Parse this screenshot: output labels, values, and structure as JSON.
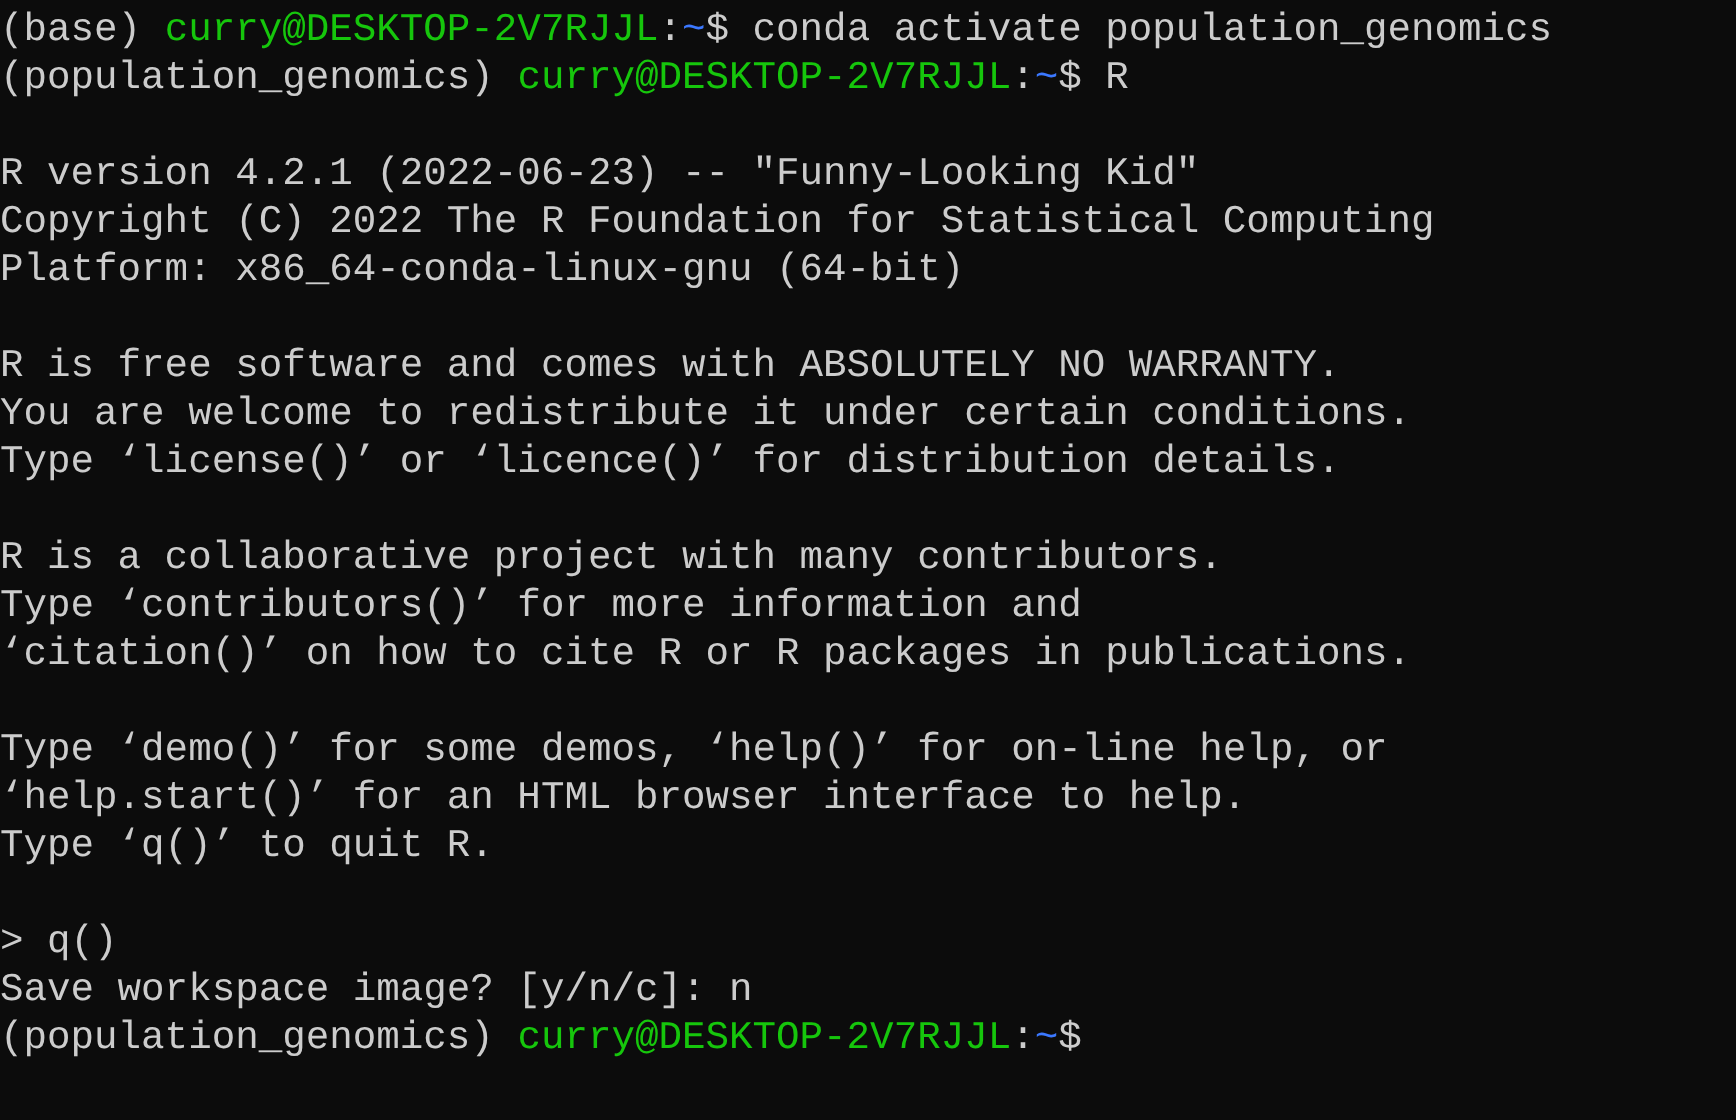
{
  "terminal": {
    "blocks": [
      {
        "lines": [
          {
            "segments": [
              {
                "kind": "plain",
                "text": "(base) "
              },
              {
                "kind": "user",
                "text": "curry@DESKTOP-2V7RJJL"
              },
              {
                "kind": "plain",
                "text": ":"
              },
              {
                "kind": "path",
                "text": "~"
              },
              {
                "kind": "plain",
                "text": "$ conda activate population_genomics"
              }
            ]
          },
          {
            "segments": [
              {
                "kind": "plain",
                "text": "(population_genomics) "
              },
              {
                "kind": "user",
                "text": "curry@DESKTOP-2V7RJJL"
              },
              {
                "kind": "plain",
                "text": ":"
              },
              {
                "kind": "path",
                "text": "~"
              },
              {
                "kind": "plain",
                "text": "$ R"
              }
            ]
          }
        ]
      },
      {
        "lines": [
          {
            "segments": [
              {
                "kind": "plain",
                "text": "R version 4.2.1 (2022-06-23) -- \"Funny-Looking Kid\""
              }
            ]
          },
          {
            "segments": [
              {
                "kind": "plain",
                "text": "Copyright (C) 2022 The R Foundation for Statistical Computing"
              }
            ]
          },
          {
            "segments": [
              {
                "kind": "plain",
                "text": "Platform: x86_64-conda-linux-gnu (64-bit)"
              }
            ]
          }
        ]
      },
      {
        "lines": [
          {
            "segments": [
              {
                "kind": "plain",
                "text": "R is free software and comes with ABSOLUTELY NO WARRANTY."
              }
            ]
          },
          {
            "segments": [
              {
                "kind": "plain",
                "text": "You are welcome to redistribute it under certain conditions."
              }
            ]
          },
          {
            "segments": [
              {
                "kind": "plain",
                "text": "Type ‘license()’ or ‘licence()’ for distribution details."
              }
            ]
          }
        ]
      },
      {
        "lines": [
          {
            "segments": [
              {
                "kind": "plain",
                "text": "R is a collaborative project with many contributors."
              }
            ]
          },
          {
            "segments": [
              {
                "kind": "plain",
                "text": "Type ‘contributors()’ for more information and"
              }
            ]
          },
          {
            "segments": [
              {
                "kind": "plain",
                "text": "‘citation()’ on how to cite R or R packages in publications."
              }
            ]
          }
        ]
      },
      {
        "lines": [
          {
            "segments": [
              {
                "kind": "plain",
                "text": "Type ‘demo()’ for some demos, ‘help()’ for on-line help, or"
              }
            ]
          },
          {
            "segments": [
              {
                "kind": "plain",
                "text": "‘help.start()’ for an HTML browser interface to help."
              }
            ]
          },
          {
            "segments": [
              {
                "kind": "plain",
                "text": "Type ‘q()’ to quit R."
              }
            ]
          }
        ]
      },
      {
        "lines": [
          {
            "segments": [
              {
                "kind": "plain",
                "text": "> q()"
              }
            ]
          },
          {
            "segments": [
              {
                "kind": "plain",
                "text": "Save workspace image? [y/n/c]: n"
              }
            ]
          },
          {
            "segments": [
              {
                "kind": "plain",
                "text": "(population_genomics) "
              },
              {
                "kind": "user",
                "text": "curry@DESKTOP-2V7RJJL"
              },
              {
                "kind": "plain",
                "text": ":"
              },
              {
                "kind": "path",
                "text": "~"
              },
              {
                "kind": "plain",
                "text": "$"
              }
            ]
          }
        ]
      }
    ]
  }
}
